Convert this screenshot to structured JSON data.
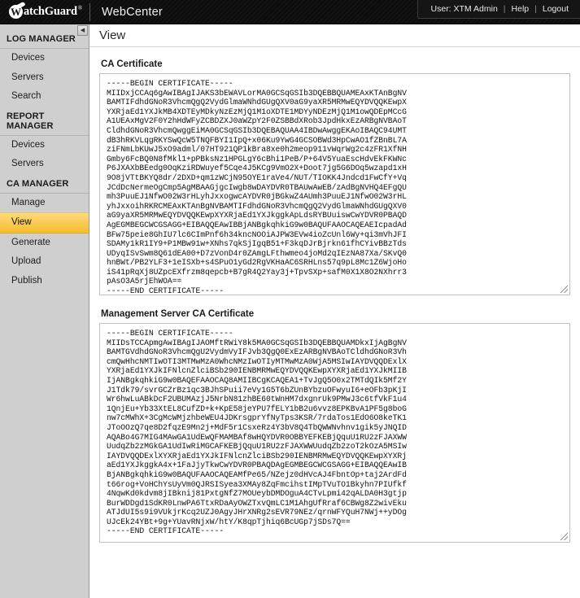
{
  "header": {
    "logo_word_w": "W",
    "logo_word_rest": "atchGuard",
    "logo_tm": "®",
    "app_title": "WebCenter",
    "user_label": "User: XTM Admin",
    "sep1": "|",
    "help_label": "Help",
    "sep2": "|",
    "logout_label": "Logout"
  },
  "sidebar": {
    "collapse_glyph": "◀",
    "groups": [
      {
        "title": "LOG MANAGER",
        "items": [
          {
            "label": "Devices",
            "active": false
          },
          {
            "label": "Servers",
            "active": false
          },
          {
            "label": "Search",
            "active": false
          }
        ]
      },
      {
        "title": "REPORT MANAGER",
        "items": [
          {
            "label": "Devices",
            "active": false
          },
          {
            "label": "Servers",
            "active": false
          }
        ]
      },
      {
        "title": "CA MANAGER",
        "items": [
          {
            "label": "Manage",
            "active": false
          },
          {
            "label": "View",
            "active": true
          },
          {
            "label": "Generate",
            "active": false
          },
          {
            "label": "Upload",
            "active": false
          },
          {
            "label": "Publish",
            "active": false
          }
        ]
      }
    ]
  },
  "main": {
    "page_title": "View",
    "ca_certificate": {
      "label": "CA Certificate",
      "text": "-----BEGIN CERTIFICATE-----\nMIIDxjCCAq6gAwIBAgIJAKS3bEWAVLorMA0GCSqGSIb3DQEBBQUAMEAxKTAnBgNV\nBAMTIFdhdGNoR3VhcmQgQ2VydGlmaWNhdGUgQXV0aG9yaXR5MRMwEQYDVQQKEwpX\nYXRjaEd1YXJkMB4XDTEyMDkyNzEzMjQ1M1oXDTE1MDYyNDEzMjQ1M1owQDEpMCcG\nA1UEAxMgV2F0Y2hHdWFyZCBDZXJ0aWZpY2F0ZSBBdXRob3JpdHkxEzARBgNVBAoT\nCldhdGNoR3VhcmQwggEiMA0GCSqGSIb3DQEBAQUAA4IBDwAwggEKAoIBAQC94UMT\ndB3hRKVLqgRKYSwQcW5TNQFBYI1IpQ+x06Ku9YwG4GCSOBWd3HpCwAO1fZBnBL7A\nziFNmLbKUwJ5xO9adml/07HT921QP1kBra8xe0h2meop911vWqrWg2c4zFR1XfNH\nGmby6FcBQ0N8fMkl1+pPBksNz1HPGLgY6cBhi1PeB/P+64V5YuaEscHdvEkFKWNc\nP6JXAXbBEedg0OqKziRDWuyef5Cqe4J5KCg9VmO2X+Doot7jg5G6DOq5wzapd1xH\n9O8jVTtBKYQ8dr/2DXD+qm1zWCjN95OYE1raVe4/NUT/TIOKK4Jndcd1FwCfY+Vq\nJCdDcNermeOgCmp5AgMBAAGjgcIwgb8wDAYDVR0TBAUwAwEB/zAdBgNVHQ4EFgQU\nmh3PuuEJ1NfwO02W3rHLyhJxxogwcAYDVR0jBGkwZ4AUmh3PuuEJ1NfwO02W3rHL\nyhJxxoihRKRCMEAxKTAnBgNVBAMTIFdhdGNoR3VhcmQgQ2VydGlmaWNhdGUgQXV0\naG9yaXR5MRMwEQYDVQQKEwpXYXRjaEd1YXJkggkApLdsRYBUuiswCwYDVR0PBAQD\nAgEGMBEGCWCGSAGG+EIBAQQEAwIBBjANBgkqhkiG9w0BAQUFAAOCAQEAEIcpadAd\nBFw75peie8GhIU7lc6CImPnf6h34kncNOOiAJPW3EVw4ioZcUnl6Wy+qi3mVhJFI\nSDAMy1kR1IY9+P1MBw91w+XNhs7qkSjIgqB51+F3kqDJrBjrkn61fhCYivBBzTds\nUDyqISvSwm8Q61dEA00+D7zVonD4r0ZAmgLFthwmeo4joMd2qIEzNA87Xa/SKvQ0\nhnBWt/PB2YLF3+1eISXb+s4SPuO1yGd2RgVKHaAC6SRHLns57q9pL8Mc1Z6WjoHo\niS41pRqXj8UZpcEXfrzm8qepcb+B7gR4Q2Yay3j+TpvSXp+safM0X1X8O2NXhrr3\npAsO3A5rjEhWOA==\n-----END CERTIFICATE-----"
    },
    "management_server_ca_certificate": {
      "label": "Management Server CA Certificate",
      "text": "-----BEGIN CERTIFICATE-----\nMIIDsTCCApmgAwIBAgIJAOMftRWiY8k5MA0GCSqGSIb3DQEBBQUAMDkxIjAgBgNV\nBAMTGVdhdGNoR3VhcmQgU2VydmVyIFJvb3QgQ0ExEzARBgNVBAoTCldhdGNoR3Vh\ncmQwHhcNMTIwOTI3MTMwMzA0WhcNMzIwOTIyMTMwMzA0WjA5MSIwIAYDVQQDExlX\nYXRjaEd1YXJkIFNlcnZlciBSb290IENBMRMwEQYDVQQKEwpXYXRjaEd1YXJkMIIB\nIjANBgkqhkiG9w0BAQEFAAOCAQ8AMIIBCgKCAQEA1+TvJgQ5O0x2TMTdQIk5Mf2Y\nJ1Tdk79/svrGCZrBz1qc3BJhSPuii7eVy1G5T6bZUnBYbzuOFwyuI6+eOFb3pKjI\nWr6hwLuABkDcF2UBUMAzjJ5NrbN81zhBE60tWnHM7dxgnrUk9PMwJ3c6tfVkF1u4\n1QnjEu+Yb33XtEL8CufZD+k+KpE58jeYPU7fELY1bB2u6vvz8EPKBvA1PF5g8boG\nnw7cMWhX+3CgMcWMjzhbeWEU4JDKrsgprYfNyTps3KSR/7rdaTos1EdO6O8keTK1\nJToOOzQ7qe8D2fqzE9Mn2j+MdF5r1CsxeRz4Y3bV8Q4TbQWWNvhnv1gik5yJNQID\nAQABo4G7MIG4MAwGA1UdEwQFMAMBAf8wHQYDVR0OBBYEFKEBjQquU1RU2zFJAXWW\nUudqZb2zMGkGA1UdIwRiMGCAFKEBjQquU1RU2zFJAXWWUudqZb2zoT2kOzA5MSIw\nIAYDVQQDExlXYXRjaEd1YXJkIFNlcnZlciBSb290IENBMRMwEQYDVQQKEwpXYXRj\naEd1YXJkggkA4x+1FaJjyTkwCwYDVR0PBAQDAgEGMBEGCWCGSAGG+EIBAQQEAwIB\nBjANBgkqhkiG9w0BAQUFAAOCAQEAMfPe65/NZejz0dHVcAJ4FbntOp+taj2ArdFd\nt66rog+VoHChYsUyVm0QJRSISyea3XMAy8ZqFmcihstIMpTVuTO1Bkyhn7PIUfkf\n4NqwKd0kdvm8jIBknij81PxtgNfZ7MOUeybDMDOguA4CTvLpmi42qALDA0H3gtjp\nBurWDDgd1SdKR0LnwPA6TtxRDaAyOWZTxvQmLC1M1AhgUfRraf6CBWg8Z2wivEku\nATJdUI5s9i9VUkjrKcq2UZJ0AgyJHrXNRg2sEVR79NEz/qrnWFYQuH7NWj++yDOg\nUJcEk24YBt+9g+YUavRNjxW/htY/K8qpTjhiq6BcUGp7jSDs7Q==\n-----END CERTIFICATE-----"
    }
  }
}
